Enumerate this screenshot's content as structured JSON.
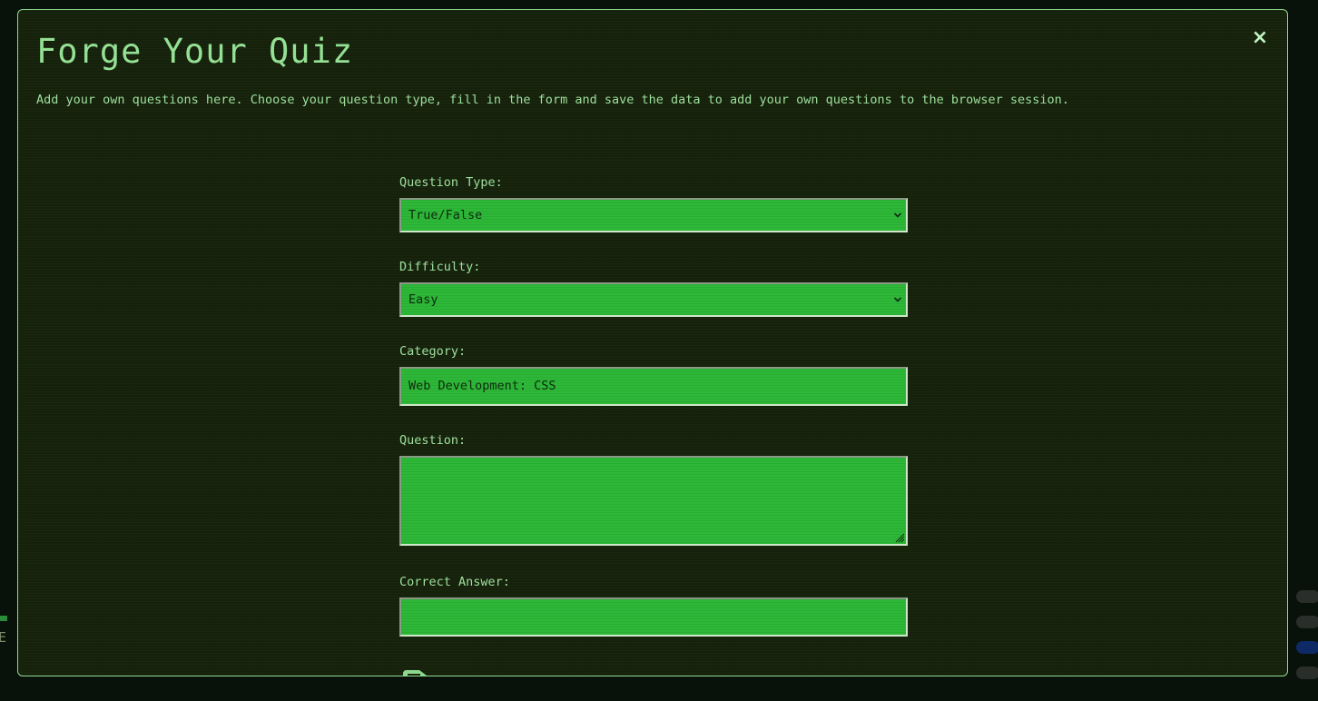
{
  "modal": {
    "title": "Forge Your Quiz",
    "close_label": "×",
    "intro": "Add your own questions here. Choose your question type, fill in the form and save the data to add your own questions to the browser session."
  },
  "form": {
    "question_type": {
      "label": "Question Type:",
      "value": "True/False"
    },
    "difficulty": {
      "label": "Difficulty:",
      "value": "Easy"
    },
    "category": {
      "label": "Category:",
      "value": "Web Development: CSS"
    },
    "question": {
      "label": "Question:",
      "value": ""
    },
    "correct_answer": {
      "label": "Correct Answer:",
      "value": ""
    },
    "save_icon": "save-icon"
  },
  "background": {
    "left_edge_char": "E"
  },
  "colors": {
    "accent": "#94e094",
    "field_fill": "#2ab634",
    "modal_bg": "#16230b",
    "border": "#8ed88e"
  }
}
